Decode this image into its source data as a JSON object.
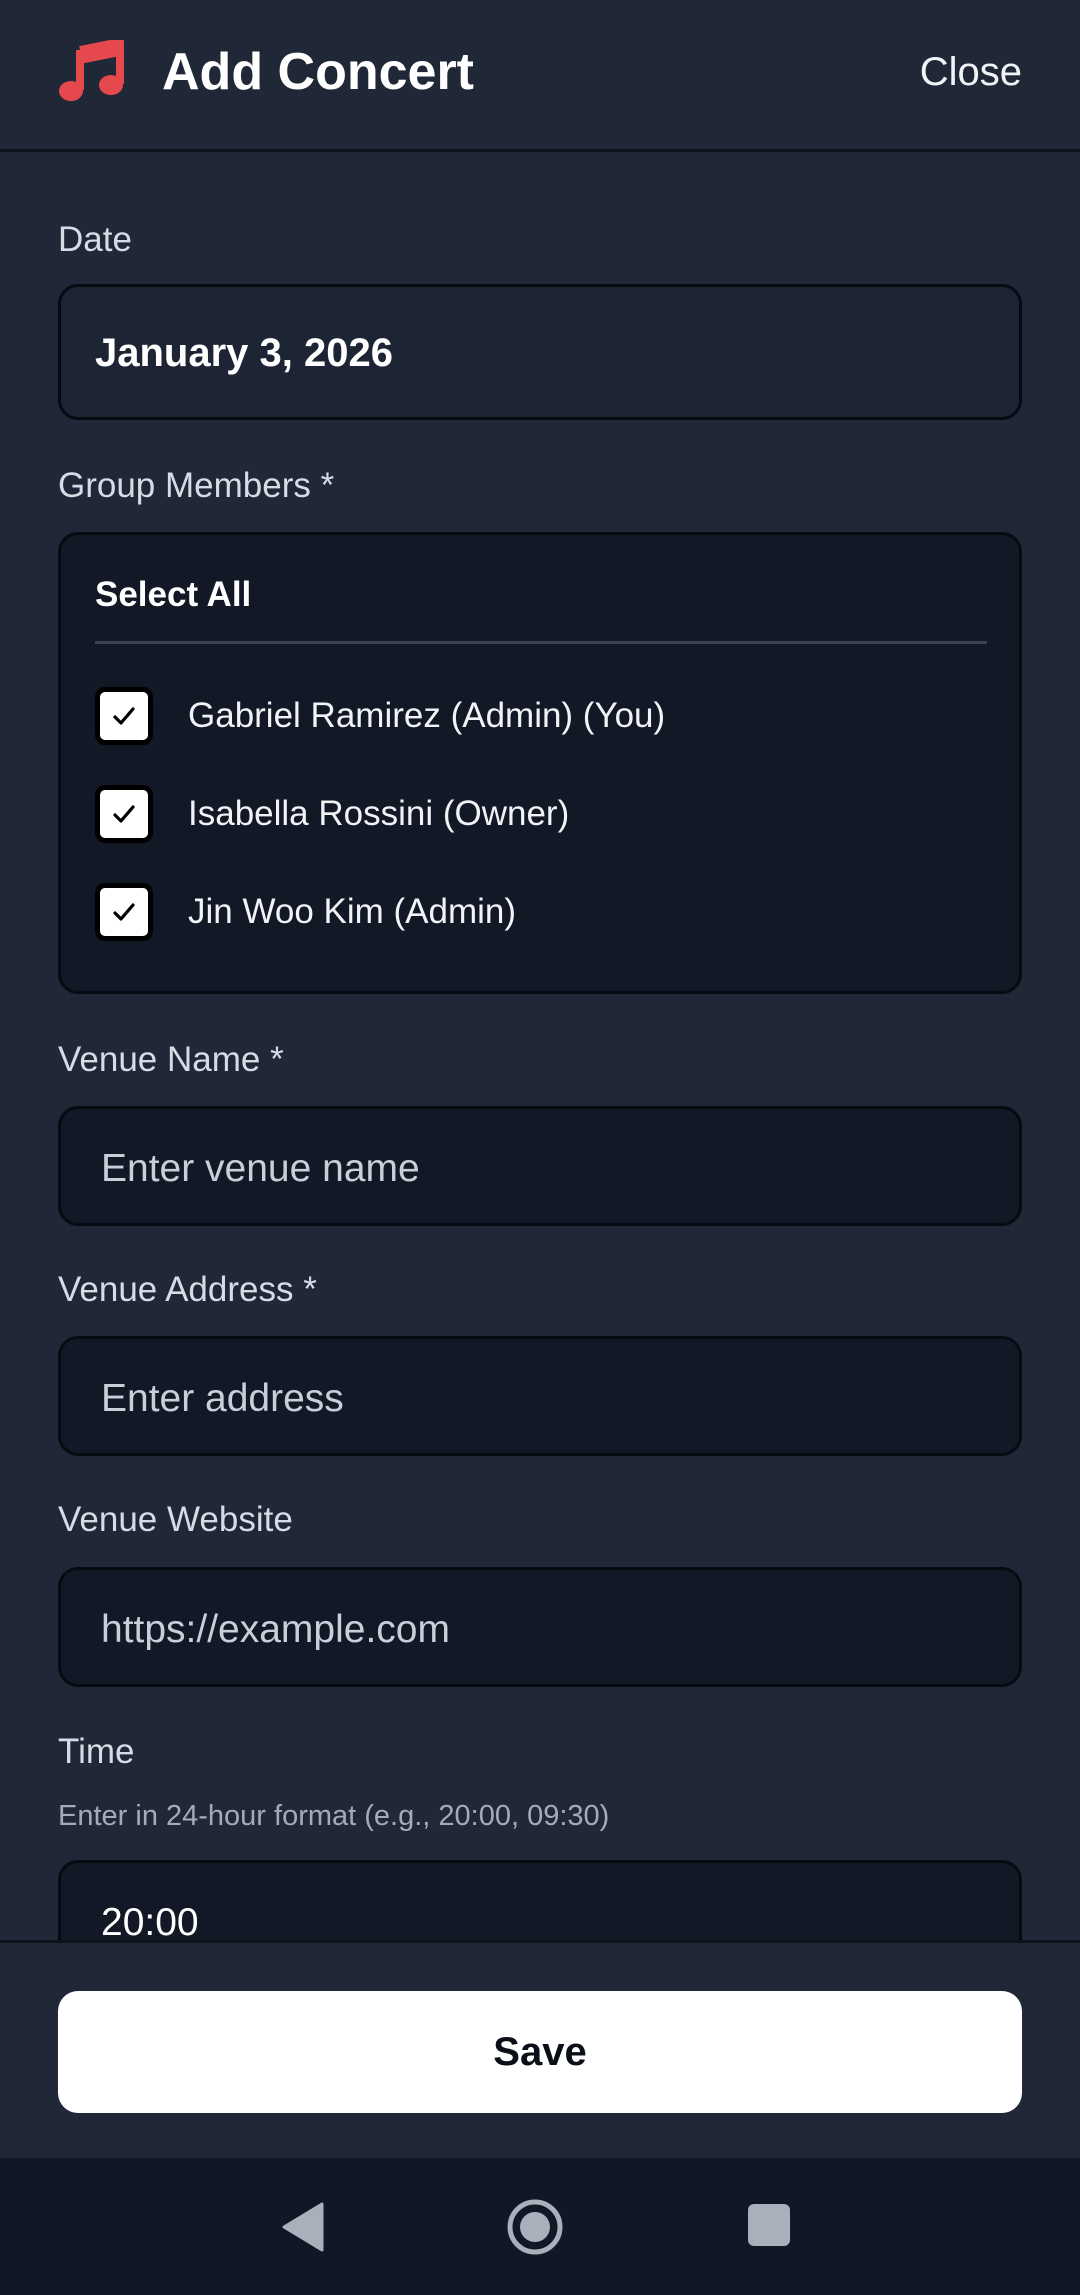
{
  "header": {
    "title": "Add Concert",
    "close_label": "Close",
    "icon": "music-note-icon",
    "accent_color": "#e5484d"
  },
  "form": {
    "date": {
      "label": "Date",
      "value": "January 3, 2026"
    },
    "members": {
      "label": "Group Members *",
      "select_all_label": "Select All",
      "items": [
        {
          "name": "Gabriel Ramirez (Admin) (You)",
          "checked": true
        },
        {
          "name": "Isabella Rossini (Owner)",
          "checked": true
        },
        {
          "name": "Jin Woo Kim (Admin)",
          "checked": true
        }
      ]
    },
    "venue_name": {
      "label": "Venue Name *",
      "placeholder": "Enter venue name"
    },
    "venue_address": {
      "label": "Venue Address *",
      "placeholder": "Enter address"
    },
    "venue_website": {
      "label": "Venue Website",
      "placeholder": "https://example.com"
    },
    "time": {
      "label": "Time",
      "hint": "Enter in 24-hour format (e.g., 20:00, 09:30)",
      "value": "20:00"
    }
  },
  "footer": {
    "save_label": "Save"
  },
  "system_nav": {
    "icons": [
      "back-icon",
      "home-icon",
      "recents-icon"
    ]
  }
}
